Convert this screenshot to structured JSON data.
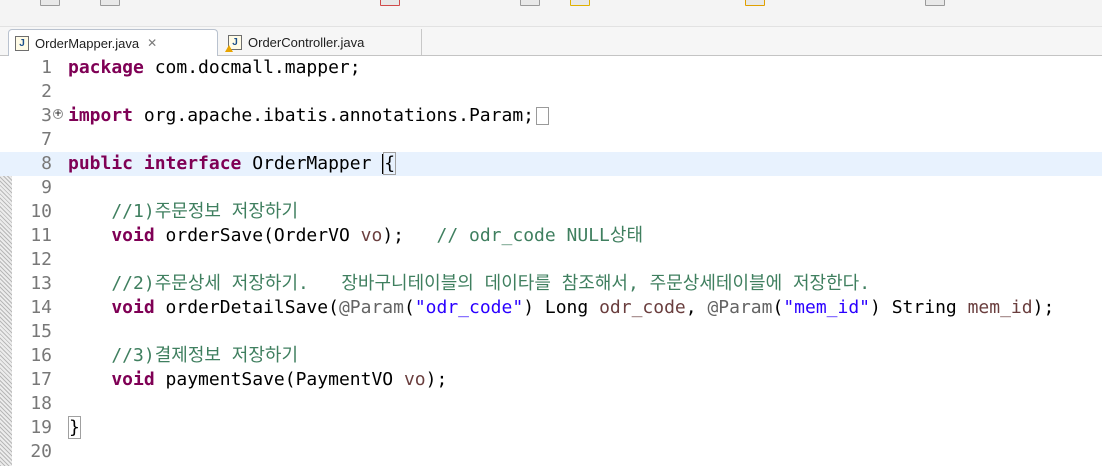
{
  "tabs": [
    {
      "label": "OrderMapper.java",
      "active": true,
      "close": "✕"
    },
    {
      "label": "OrderController.java",
      "active": false,
      "warning": true
    }
  ],
  "lines": [
    {
      "n": "1",
      "segs": [
        [
          "kw",
          "package"
        ],
        [
          "",
          "com.docmall.mapper;"
        ]
      ]
    },
    {
      "n": "2",
      "segs": []
    },
    {
      "n": "3",
      "segs": [
        [
          "kw",
          "import"
        ],
        [
          "",
          "org.apache.ibatis.annotations.Param;"
        ]
      ],
      "fold": "⊕"
    },
    {
      "n": "7",
      "segs": []
    },
    {
      "n": "8",
      "segs": [
        [
          "kw",
          "public"
        ],
        [
          "kw",
          "interface"
        ],
        [
          "",
          "OrderMapper "
        ],
        [
          "",
          "{"
        ]
      ]
    },
    {
      "n": "9",
      "segs": []
    },
    {
      "n": "10",
      "segs": [
        [
          "cm",
          "    //1)주문정보 저장하기"
        ]
      ]
    },
    {
      "n": "11",
      "segs": [
        [
          "kw",
          "    void"
        ],
        [
          "",
          "orderSave(OrderVO"
        ],
        [
          "pr",
          "vo"
        ],
        [
          "",
          ");"
        ],
        [
          "cm",
          "  // odr_code NULL상태"
        ]
      ]
    },
    {
      "n": "12",
      "segs": []
    },
    {
      "n": "13",
      "segs": [
        [
          "cm",
          "    //2)주문상세 저장하기.   장바구니테이블의 데이타를 참조해서, 주문상세테이블에 저장한다."
        ]
      ]
    },
    {
      "n": "14",
      "segs": [
        [
          "kw",
          "    void"
        ],
        [
          "",
          "orderDetailSave("
        ],
        [
          "an",
          "@Param"
        ],
        [
          "",
          "("
        ],
        [
          "st",
          "\"odr_code\""
        ],
        [
          "",
          ")"
        ],
        [
          "",
          "Long"
        ],
        [
          "pr",
          "odr_code"
        ],
        [
          "",
          ", "
        ],
        [
          "an",
          "@Param"
        ],
        [
          "",
          "("
        ],
        [
          "st",
          "\"mem_id\""
        ],
        [
          "",
          ")"
        ],
        [
          "",
          "String"
        ],
        [
          "pr",
          "mem_id"
        ],
        [
          "",
          ");"
        ]
      ]
    },
    {
      "n": "15",
      "segs": []
    },
    {
      "n": "16",
      "segs": [
        [
          "cm",
          "    //3)결제정보 저장하기"
        ]
      ]
    },
    {
      "n": "17",
      "segs": [
        [
          "kw",
          "    void"
        ],
        [
          "",
          "paymentSave(PaymentVO"
        ],
        [
          "pr",
          "vo"
        ],
        [
          "",
          ");"
        ]
      ]
    },
    {
      "n": "18",
      "segs": []
    },
    {
      "n": "19",
      "segs": [
        [
          "",
          "}"
        ]
      ]
    },
    {
      "n": "20",
      "segs": []
    }
  ]
}
